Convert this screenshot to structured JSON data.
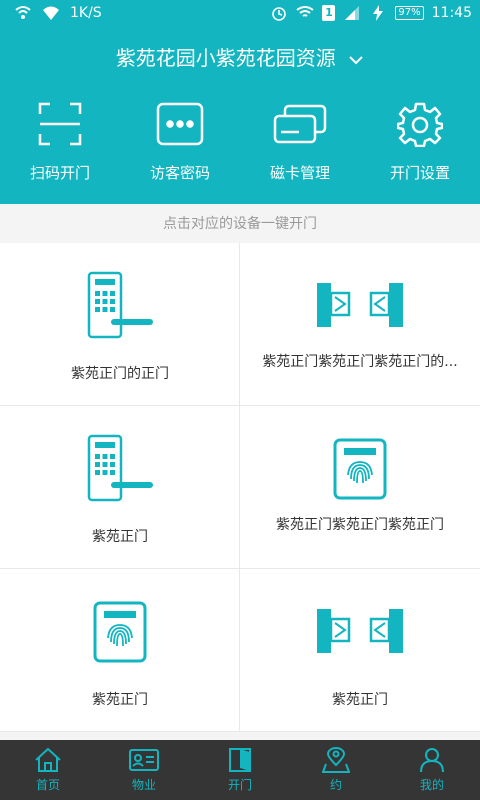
{
  "status_bar": {
    "network_speed": "1K/S",
    "sim": "1",
    "battery": "97%",
    "time": "11:45"
  },
  "header": {
    "community": "紫苑花园小紫苑花园资源"
  },
  "actions": [
    {
      "label": "扫码开门",
      "icon": "scan-icon"
    },
    {
      "label": "访客密码",
      "icon": "dots-icon"
    },
    {
      "label": "磁卡管理",
      "icon": "cards-icon"
    },
    {
      "label": "开门设置",
      "icon": "gear-icon"
    }
  ],
  "hint": "点击对应的设备一键开门",
  "devices": [
    {
      "name": "紫苑正门的正门",
      "type": "keypad-lock"
    },
    {
      "name": "紫苑正门紫苑正门紫苑正门的...",
      "type": "turnstile"
    },
    {
      "name": "紫苑正门",
      "type": "keypad-lock"
    },
    {
      "name": "紫苑正门紫苑正门紫苑正门",
      "type": "fingerprint"
    },
    {
      "name": "紫苑正门",
      "type": "fingerprint"
    },
    {
      "name": "紫苑正门",
      "type": "turnstile"
    }
  ],
  "bottom_nav": [
    {
      "label": "首页",
      "icon": "home-icon"
    },
    {
      "label": "物业",
      "icon": "id-card-icon"
    },
    {
      "label": "开门",
      "icon": "door-icon"
    },
    {
      "label": "约",
      "icon": "location-icon"
    },
    {
      "label": "我的",
      "icon": "user-icon"
    }
  ],
  "colors": {
    "accent": "#12b5c0",
    "nav_bg": "#353535"
  }
}
